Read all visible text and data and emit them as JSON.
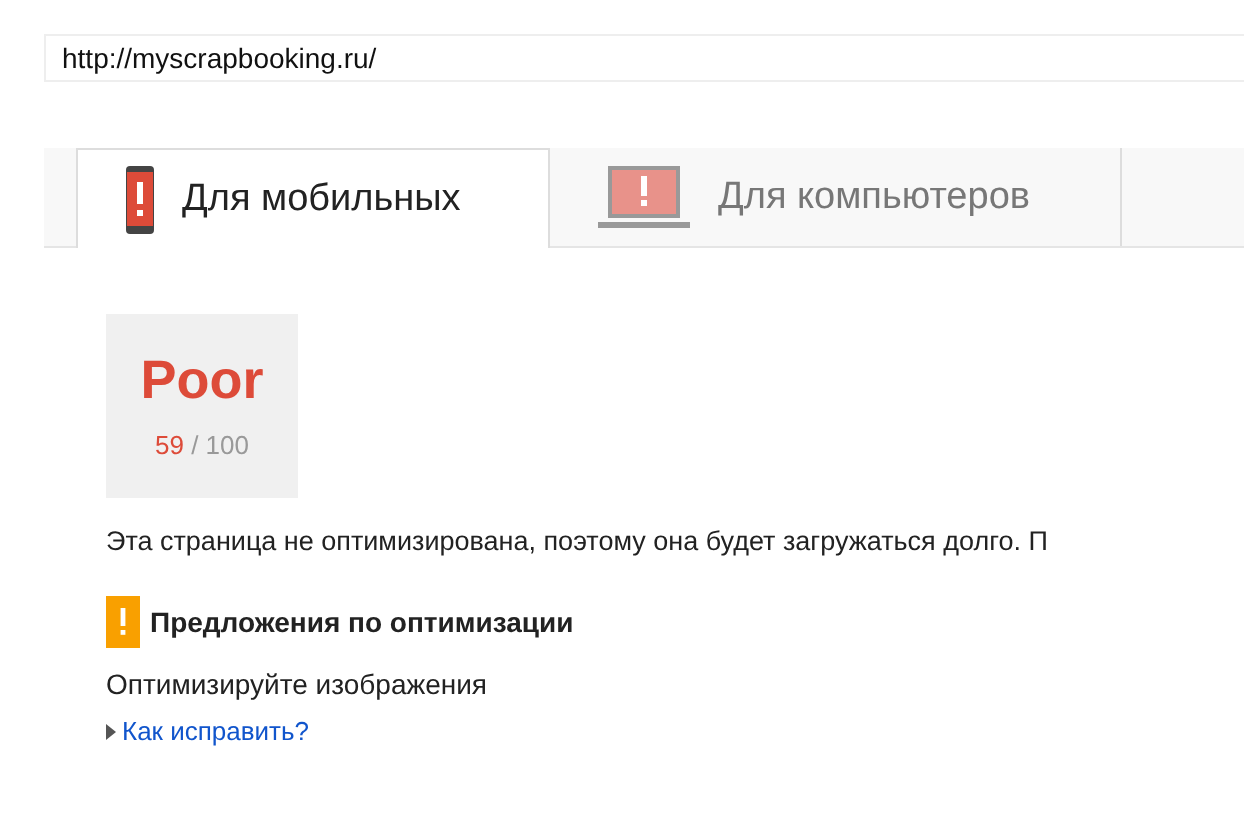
{
  "url_field": {
    "value": "http://myscrapbooking.ru/"
  },
  "tabs": [
    {
      "label": "Для мобильных",
      "kind": "mobile",
      "selected": true
    },
    {
      "label": "Для компьютеров",
      "kind": "desktop",
      "selected": false
    }
  ],
  "score": {
    "rating": "Poor",
    "value": "59",
    "separator": "/",
    "max": "100"
  },
  "summary": "Эта страница не оптимизирована, поэтому она будет загружаться долго. П",
  "suggestions": {
    "title": "Предложения по оптимизации",
    "items": [
      {
        "name": "Оптимизируйте изображения",
        "link": "Как исправить?",
        "expanded": false
      }
    ]
  }
}
